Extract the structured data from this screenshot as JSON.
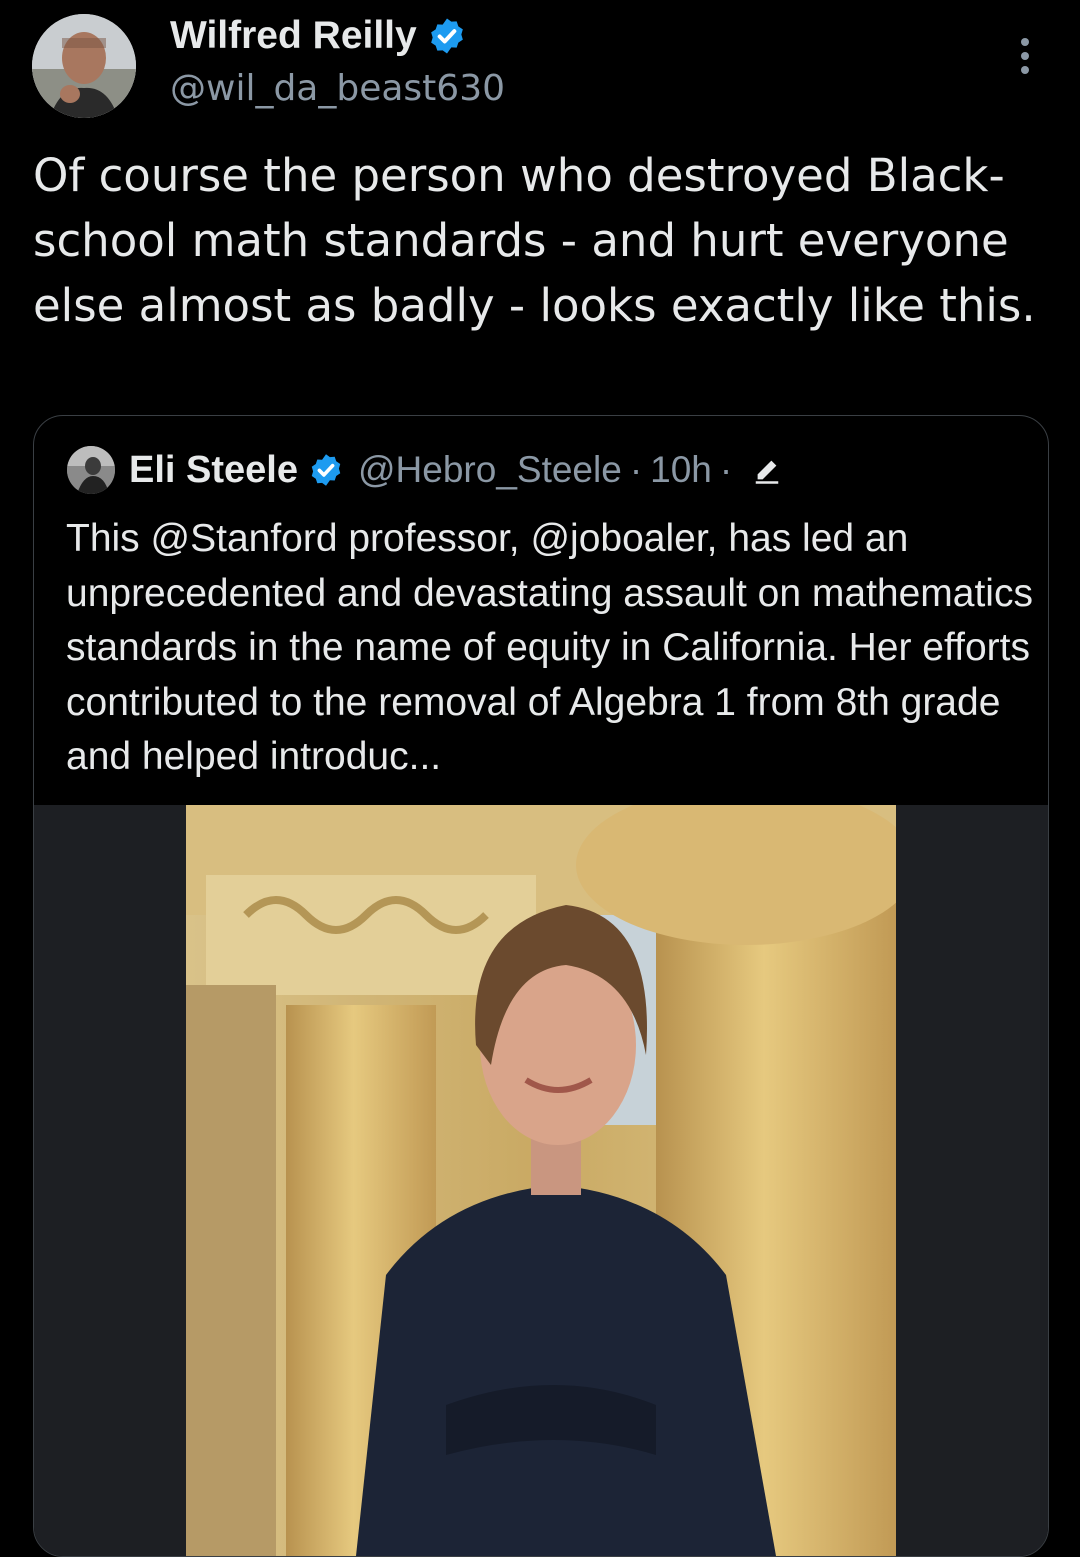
{
  "tweet": {
    "author_name": "Wilfred Reilly",
    "author_handle": "@wil_da_beast630",
    "text": "Of course the person who destroyed Black-school math standards - and hurt everyone else almost as badly - looks exactly like this."
  },
  "quoted": {
    "author_name": "Eli Steele",
    "author_handle": "@Hebro_Steele",
    "separator": "·",
    "time": "10h",
    "text": "This @Stanford professor, @joboaler, has led an unprecedented and devastating assault on mathematics standards in the name of equity in California. Her efforts contributed to the removal of Algebra 1 from 8th grade and helped introduc..."
  },
  "icons": {
    "verified": "verified-badge-icon",
    "more": "more-options-icon",
    "edit": "edited-pencil-icon"
  },
  "colors": {
    "background": "#000000",
    "text": "#e7e9ea",
    "secondary": "#8b98a5",
    "verified": "#1d9bf0",
    "card_border": "#3a3f44"
  }
}
